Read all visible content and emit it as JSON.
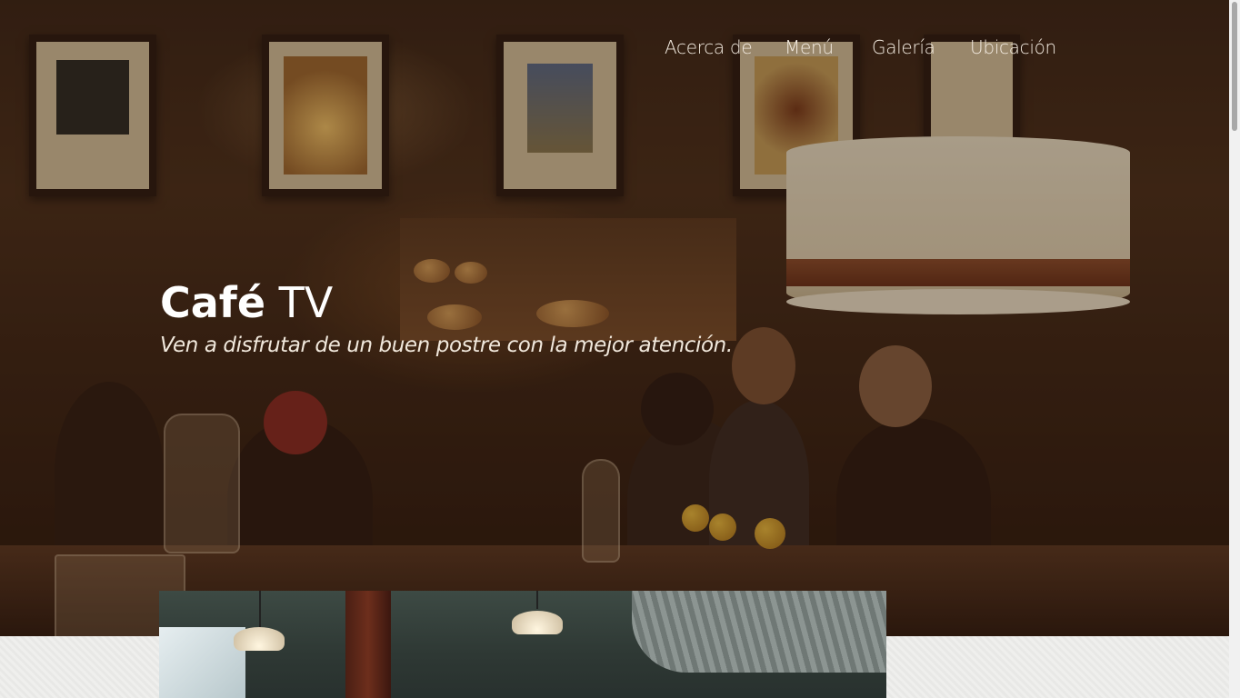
{
  "nav": {
    "items": [
      {
        "label": "Acerca de"
      },
      {
        "label": "Menú"
      },
      {
        "label": "Galería"
      },
      {
        "label": "Ubicación"
      }
    ]
  },
  "hero": {
    "title_bold": "Café",
    "title_light": "TV",
    "tagline": "Ven a disfrutar de un buen postre con la mejor atención."
  },
  "colors": {
    "hero_overlay": "#2a170c",
    "text_primary": "#ffffff",
    "section_background": "#ececea"
  }
}
